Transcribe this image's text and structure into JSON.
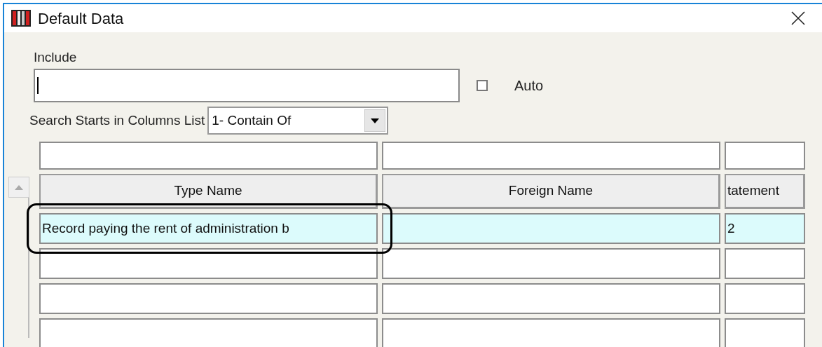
{
  "window": {
    "title": "Default Data"
  },
  "include": {
    "label": "Include"
  },
  "auto": {
    "label": "Auto",
    "checked": false
  },
  "search_mode": {
    "label": "Search Starts in Columns List",
    "value": "1- Contain Of"
  },
  "table": {
    "columns": [
      "Type Name",
      "Foreign Name",
      "tatement"
    ],
    "rows": [
      {
        "type_name": "Record paying the rent of administration b",
        "column_3": "2",
        "selected": true
      },
      {
        "selected": false
      },
      {
        "selected": false
      },
      {
        "selected": false
      }
    ]
  }
}
